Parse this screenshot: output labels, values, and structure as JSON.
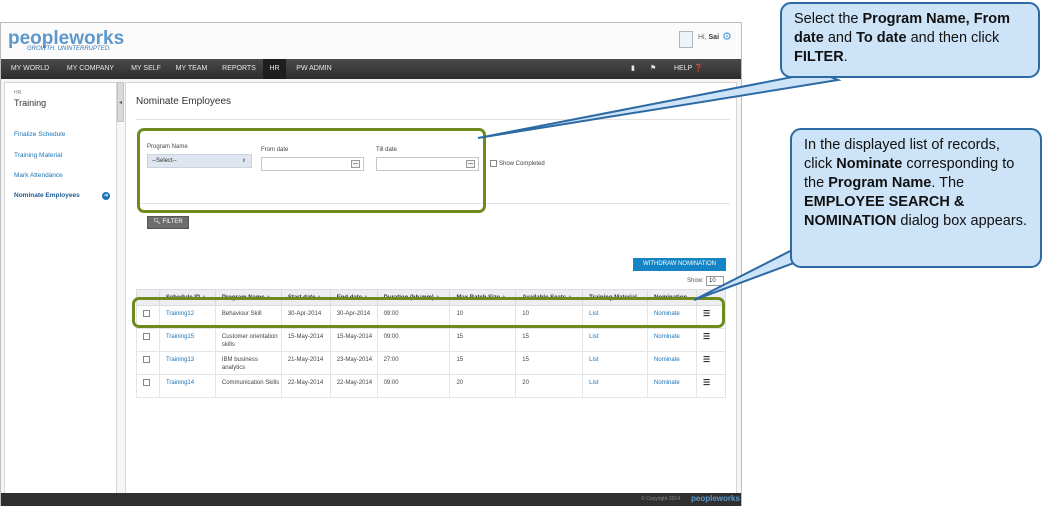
{
  "app": {
    "logo": "peopleworks",
    "tagline": "GROWTH. UNINTERRUPTED.",
    "greeting": "Hi,",
    "user": "Sai"
  },
  "nav": {
    "items": [
      "MY WORLD",
      "MY COMPANY",
      "MY SELF",
      "MY TEAM",
      "REPORTS",
      "HR",
      "PW ADMIN"
    ],
    "active": "HR",
    "help": "HELP"
  },
  "sidebar": {
    "section": "HR",
    "title": "Training",
    "items": [
      "Finalize Schedule",
      "Training Material",
      "Mark Attendance",
      "Nominate Employees"
    ],
    "active_item": "Nominate Employees"
  },
  "page": {
    "title": "Nominate Employees"
  },
  "filter": {
    "program_label": "Program Name",
    "program_value": "--Select--",
    "from_label": "From date",
    "till_label": "Till date",
    "show_completed": "Show Completed",
    "filter_button": "FILTER"
  },
  "actions": {
    "withdraw": "WITHDRAW NOMINATION",
    "show_label": "Show:",
    "show_value": "10"
  },
  "table": {
    "headers": [
      "Schedule ID",
      "Program Name",
      "Start date",
      "End date",
      "Duration (hh:mm)",
      "Max Batch Size",
      "Available Seats",
      "Training Material",
      "Nomination"
    ],
    "rows": [
      {
        "id": "Training12",
        "program": "Behaviour Skill",
        "start": "30-Apr-2014",
        "end": "30-Apr-2014",
        "duration": "09:00",
        "max": "10",
        "seats": "10",
        "material": "List",
        "nomination": "Nominate"
      },
      {
        "id": "Training15",
        "program": "Customer orientation skills",
        "start": "15-May-2014",
        "end": "15-May-2014",
        "duration": "09:00",
        "max": "15",
        "seats": "15",
        "material": "List",
        "nomination": "Nominate"
      },
      {
        "id": "Training13",
        "program": "IBM business analytics",
        "start": "21-May-2014",
        "end": "23-May-2014",
        "duration": "27:00",
        "max": "15",
        "seats": "15",
        "material": "List",
        "nomination": "Nominate"
      },
      {
        "id": "Training14",
        "program": "Communication Skills",
        "start": "22-May-2014",
        "end": "22-May-2014",
        "duration": "09:00",
        "max": "20",
        "seats": "20",
        "material": "List",
        "nomination": "Nominate"
      }
    ]
  },
  "footer": {
    "copyright": "© Copyright 2014",
    "logo": "peopleworks"
  },
  "callouts": {
    "first": {
      "t1": "Select the ",
      "b1": "Program Name,",
      "b2": "From date",
      "t2": " and ",
      "b3": "To date",
      "t3": " and then click ",
      "b4": "FILTER",
      "t4": "."
    },
    "second": {
      "t1": "In the displayed list of records, click ",
      "b1": "Nominate",
      "t2": " corresponding to the ",
      "b2": "Program Name",
      "t3": ". The ",
      "b3": "EMPLOYEE SEARCH & NOMINATION",
      "t4": " dialog box appears."
    }
  },
  "colors": {
    "accent": "#1484c4",
    "highlight": "#6f8b1f",
    "callout_bg": "#cde3f7",
    "callout_border": "#2d6aa3",
    "nav_bg": "#2d2d2d"
  }
}
